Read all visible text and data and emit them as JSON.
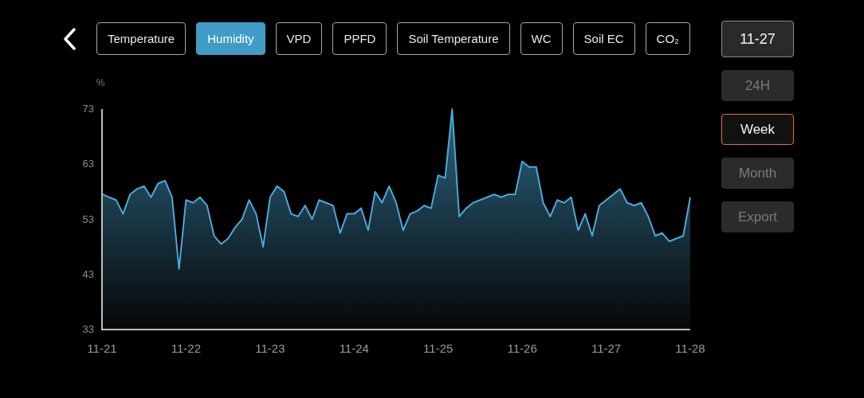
{
  "back_button": {
    "kind": "back"
  },
  "tabs": [
    {
      "label": "Temperature",
      "selected": false
    },
    {
      "label": "Humidity",
      "selected": true
    },
    {
      "label": "VPD",
      "selected": false
    },
    {
      "label": "PPFD",
      "selected": false
    },
    {
      "label": "Soil Temperature",
      "selected": false
    },
    {
      "label": "WC",
      "selected": false
    },
    {
      "label": "Soil EC",
      "selected": false
    },
    {
      "label": "CO₂",
      "selected": false
    }
  ],
  "date_button": {
    "label": "11-27"
  },
  "ranges": [
    {
      "label": "24H",
      "selected": false
    },
    {
      "label": "Week",
      "selected": true
    },
    {
      "label": "Month",
      "selected": false
    }
  ],
  "export_button": {
    "label": "Export"
  },
  "chart": {
    "chart_data": {
      "type": "area",
      "ylabel": "%",
      "categories": [
        "11-21",
        null,
        null,
        null,
        null,
        null,
        null,
        null,
        null,
        null,
        null,
        null,
        "11-22",
        null,
        null,
        null,
        null,
        null,
        null,
        null,
        null,
        null,
        null,
        null,
        "11-23",
        null,
        null,
        null,
        null,
        null,
        null,
        null,
        null,
        null,
        null,
        null,
        "11-24",
        null,
        null,
        null,
        null,
        null,
        null,
        null,
        null,
        null,
        null,
        null,
        "11-25",
        null,
        null,
        null,
        null,
        null,
        null,
        null,
        null,
        null,
        null,
        null,
        "11-26",
        null,
        null,
        null,
        null,
        null,
        null,
        null,
        null,
        null,
        null,
        null,
        "11-27",
        null,
        null,
        null,
        null,
        null,
        null,
        null,
        null,
        null,
        null,
        null,
        "11-28"
      ],
      "values": [
        57.6,
        57,
        56.5,
        54,
        57.5,
        58.5,
        59,
        57,
        59.5,
        60,
        57,
        44,
        56.5,
        56,
        57,
        55.5,
        50,
        48.5,
        49.5,
        51.5,
        53,
        56.5,
        54,
        48,
        57,
        59,
        58,
        54,
        53.5,
        55.5,
        53,
        56.5,
        56,
        55.5,
        50.5,
        54,
        54,
        55,
        51,
        58,
        56,
        59,
        56,
        51,
        54,
        54.5,
        55.5,
        55,
        61,
        60.5,
        73,
        53.5,
        55,
        56,
        56.5,
        57,
        57.5,
        57,
        57.5,
        57.5,
        63.5,
        62.5,
        62.5,
        56,
        53.5,
        56.5,
        56,
        57,
        51,
        54,
        50,
        55.5,
        56.5,
        57.5,
        58.5,
        56,
        55.5,
        56,
        53.5,
        50,
        50.5,
        49,
        49.5,
        50,
        57
      ],
      "ylim": [
        33,
        73
      ],
      "yticks": [
        33,
        43,
        53,
        63,
        73
      ]
    }
  }
}
